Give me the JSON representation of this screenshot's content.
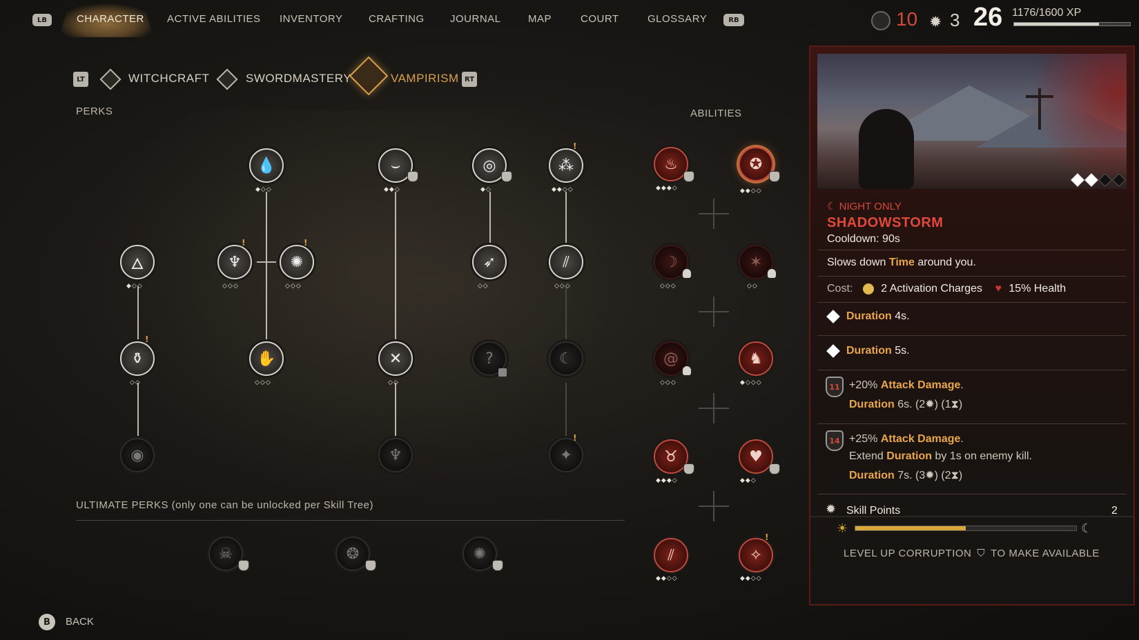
{
  "topnav": {
    "lb": "LB",
    "rb": "RB",
    "tabs": [
      "CHARACTER",
      "ACTIVE ABILITIES",
      "INVENTORY",
      "CRAFTING",
      "JOURNAL",
      "MAP",
      "COURT",
      "GLOSSARY"
    ],
    "active_tab": "CHARACTER",
    "corruption_value": "10",
    "skill_points_value": "3",
    "level": "26",
    "xp_text": "1176/1600 XP",
    "xp_progress": 0.735
  },
  "subtabs": {
    "lt": "LT",
    "rt": "RT",
    "items": [
      "WITCHCRAFT",
      "SWORDMASTERY",
      "VAMPIRISM"
    ],
    "active": "VAMPIRISM"
  },
  "sections": {
    "perks": "PERKS",
    "abilities": "ABILITIES",
    "ultimate": "ULTIMATE PERKS (only one can be unlocked per Skill Tree)"
  },
  "perk_glyphs": {
    "unknown": "?"
  },
  "detail": {
    "condition": "NIGHT ONLY",
    "title": "SHADOWSTORM",
    "cooldown": "Cooldown: 90s",
    "desc_pre": "Slows down ",
    "desc_key": "Time",
    "desc_post": " around you.",
    "cost_label": "Cost:",
    "cost_charges": "2 Activation Charges",
    "cost_health": "15% Health",
    "rank1_key": "Duration",
    "rank1_val": " 4s.",
    "rank2_key": "Duration",
    "rank2_val": " 5s.",
    "up1_level": "11",
    "up1_pct": "+20% ",
    "up1_key": "Attack Damage",
    "up1_dot": ".",
    "up1_dur_key": "Duration",
    "up1_dur_val": " 6s.  (2",
    "up1_mid": ") (1",
    "up1_end": ")",
    "up2_level": "14",
    "up2_pct": "+25% ",
    "up2_key": "Attack Damage",
    "up2_dot": ".",
    "up2_ext_pre": "Extend ",
    "up2_ext_key": "Duration",
    "up2_ext_post": " by 1s on enemy kill.",
    "up2_dur_key": "Duration",
    "up2_dur_val": " 7s.  (3",
    "up2_mid": ") (2",
    "up2_end": ")",
    "skill_points_label": "Skill Points",
    "skill_points_num": "2",
    "corruption_progress": 0.5,
    "level_up_pre": "LEVEL UP CORRUPTION",
    "level_up_post": "TO MAKE AVAILABLE"
  },
  "footer": {
    "b": "B",
    "back": "BACK"
  },
  "colors": {
    "accent_gold": "#d9a14e",
    "accent_red": "#d2493b",
    "highlight": "#e9a64a"
  }
}
